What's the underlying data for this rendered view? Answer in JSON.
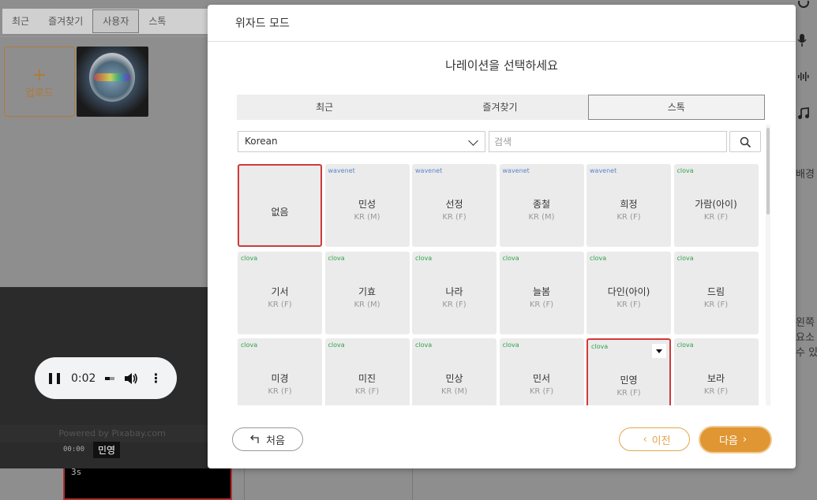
{
  "background": {
    "tabs": [
      {
        "label": "최근",
        "selected": false
      },
      {
        "label": "즐겨찾기",
        "selected": false
      },
      {
        "label": "사용자",
        "selected": true
      },
      {
        "label": "스톡",
        "selected": false
      }
    ],
    "upload_label": "업로드",
    "upload_plus": "+",
    "right_text_1": "배경",
    "right_text_2": "왼쪽",
    "right_text_3": "요소",
    "right_text_4": "수 있",
    "audio": {
      "time": "0:02"
    },
    "powered_by": "Powered by Pixabay.com",
    "ruler": "00:00",
    "tooltip": "민영",
    "clip_label": "3s"
  },
  "modal": {
    "title": "위자드 모드",
    "heading": "나레이션을 선택하세요",
    "tabs": [
      {
        "label": "최근",
        "selected": false
      },
      {
        "label": "즐겨찾기",
        "selected": false
      },
      {
        "label": "스톡",
        "selected": true
      }
    ],
    "language": "Korean",
    "search_placeholder": "검색",
    "none_label": "없음",
    "voices": [
      {
        "engine": "wavenet",
        "name": "민성",
        "sub": "KR (M)"
      },
      {
        "engine": "wavenet",
        "name": "선정",
        "sub": "KR (F)"
      },
      {
        "engine": "wavenet",
        "name": "종철",
        "sub": "KR (M)"
      },
      {
        "engine": "wavenet",
        "name": "희정",
        "sub": "KR (F)"
      },
      {
        "engine": "clova",
        "name": "가람(아이)",
        "sub": "KR (F)"
      },
      {
        "engine": "clova",
        "name": "기서",
        "sub": "KR (F)"
      },
      {
        "engine": "clova",
        "name": "기효",
        "sub": "KR (M)"
      },
      {
        "engine": "clova",
        "name": "나라",
        "sub": "KR (F)"
      },
      {
        "engine": "clova",
        "name": "늘봄",
        "sub": "KR (F)"
      },
      {
        "engine": "clova",
        "name": "다인(아이)",
        "sub": "KR (F)"
      },
      {
        "engine": "clova",
        "name": "드림",
        "sub": "KR (F)"
      },
      {
        "engine": "clova",
        "name": "미경",
        "sub": "KR (F)"
      },
      {
        "engine": "clova",
        "name": "미진",
        "sub": "KR (F)"
      },
      {
        "engine": "clova",
        "name": "민상",
        "sub": "KR (M)"
      },
      {
        "engine": "clova",
        "name": "민서",
        "sub": "KR (F)"
      },
      {
        "engine": "clova",
        "name": "민영",
        "sub": "KR (F)",
        "selected": true
      },
      {
        "engine": "clova",
        "name": "보라",
        "sub": "KR (F)"
      }
    ],
    "buttons": {
      "home": "처음",
      "prev": "이전",
      "next": "다음"
    },
    "colors": {
      "accent": "#e09633",
      "selected_border": "#d03a3a",
      "wavenet": "#5a86c9",
      "clova": "#2fa34a"
    }
  }
}
